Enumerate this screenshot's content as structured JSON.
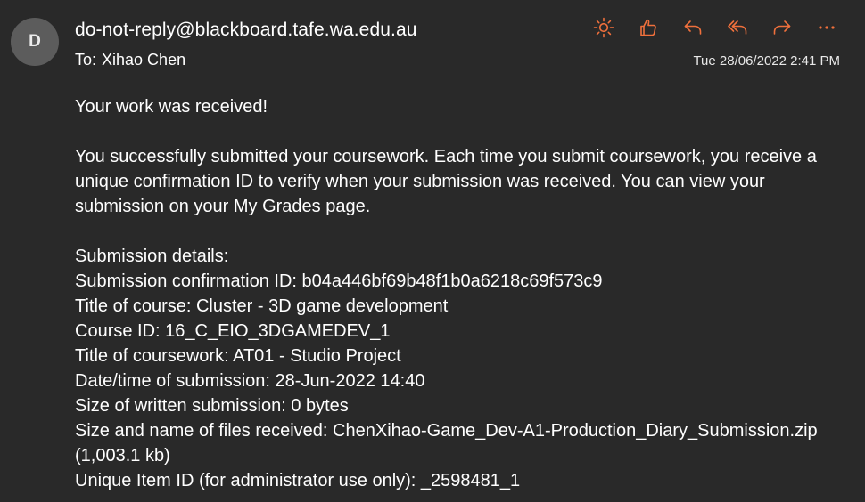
{
  "header": {
    "avatar_initial": "D",
    "sender": "do-not-reply@blackboard.tafe.wa.edu.au",
    "to_label": "To:",
    "recipient": "Xihao Chen",
    "datetime": "Tue 28/06/2022 2:41 PM",
    "accent_color": "#f0703c"
  },
  "toolbar": {
    "icons": [
      "sun-icon",
      "thumbs-up-icon",
      "reply-icon",
      "reply-all-icon",
      "forward-icon",
      "more-icon"
    ]
  },
  "body": {
    "headline": "Your work was received!",
    "intro": "You successfully submitted your coursework. Each time you submit coursework, you receive a unique confirmation ID to verify when your submission was received. You can view your submission on your My Grades page.",
    "details": [
      "Submission details:",
      "Submission confirmation ID: b04a446bf69b48f1b0a6218c69f573c9",
      "Title of course: Cluster - 3D game development",
      "Course ID: 16_C_EIO_3DGAMEDEV_1",
      "Title of coursework: AT01 - Studio Project",
      "Date/time of submission: 28-Jun-2022 14:40",
      "Size of written submission: 0 bytes",
      "Size and name of files received: ChenXihao-Game_Dev-A1-Production_Diary_Submission.zip (1,003.1 kb)",
      "Unique Item ID (for administrator use only): _2598481_1"
    ]
  }
}
